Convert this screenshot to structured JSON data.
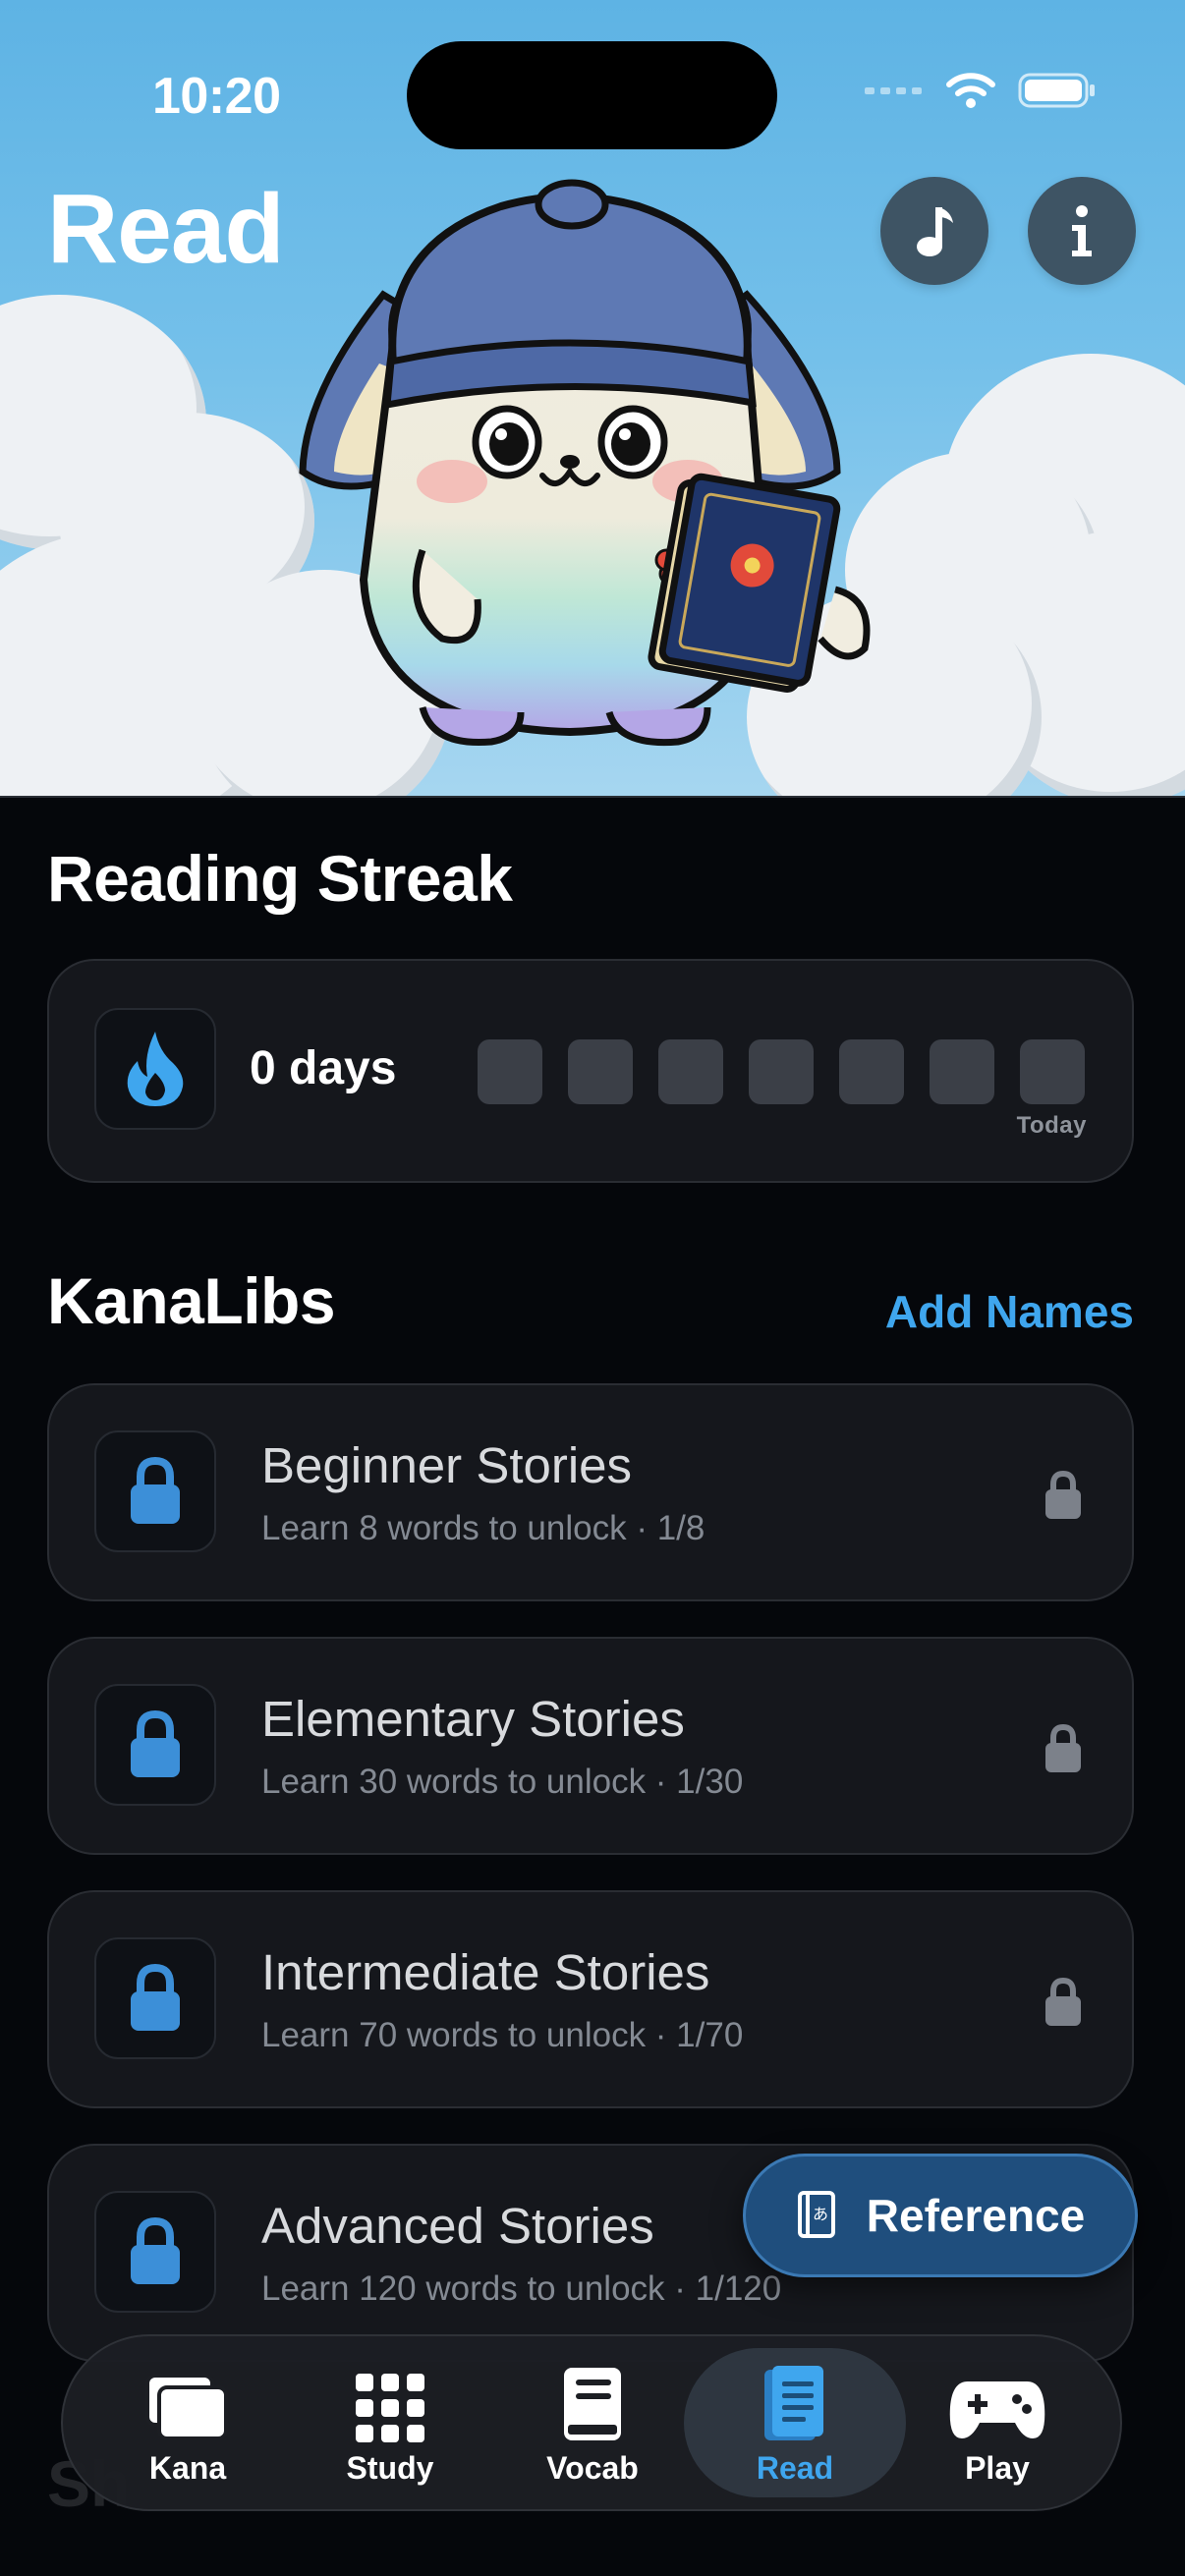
{
  "status_bar": {
    "time": "10:20"
  },
  "header": {
    "title": "Read",
    "music_button_icon": "music-note-icon",
    "info_button_icon": "info-icon"
  },
  "streak": {
    "section_title": "Reading Streak",
    "days_label": "0 days",
    "day_count": 0,
    "week_boxes": 7,
    "today_label": "Today",
    "icon": "flame-icon"
  },
  "kanalibs": {
    "section_title": "KanaLibs",
    "add_names_label": "Add Names",
    "stories": [
      {
        "title": "Beginner Stories",
        "subtitle": "Learn 8 words to unlock · 1/8",
        "locked": true
      },
      {
        "title": "Elementary Stories",
        "subtitle": "Learn 30 words to unlock · 1/30",
        "locked": true
      },
      {
        "title": "Intermediate Stories",
        "subtitle": "Learn 70 words to unlock · 1/70",
        "locked": true
      },
      {
        "title": "Advanced Stories",
        "subtitle": "Learn 120 words to unlock · 1/120",
        "locked": true
      }
    ]
  },
  "reference_button": {
    "label": "Reference",
    "icon": "kana-book-icon"
  },
  "tabs": [
    {
      "label": "Kana",
      "icon": "cards-icon",
      "active": false
    },
    {
      "label": "Study",
      "icon": "grid-icon",
      "active": false
    },
    {
      "label": "Vocab",
      "icon": "book-icon",
      "active": false
    },
    {
      "label": "Read",
      "icon": "reading-book-icon",
      "active": true
    },
    {
      "label": "Play",
      "icon": "gamepad-icon",
      "active": false
    }
  ],
  "colors": {
    "accent": "#3fa6ee",
    "background": "#05070b",
    "card": "#15171c",
    "sky": "#6bbbe8"
  }
}
